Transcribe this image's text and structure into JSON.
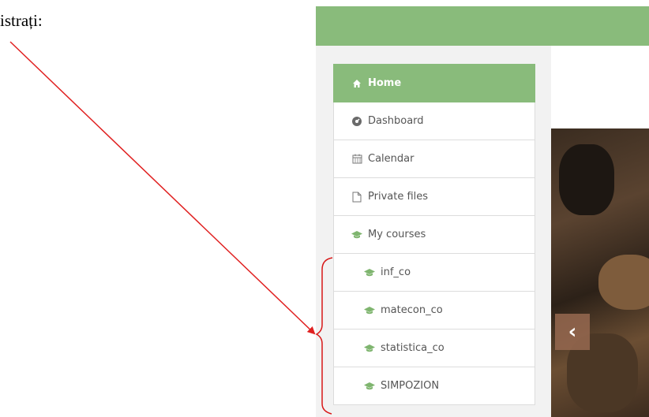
{
  "caption": {
    "text": "istrați:"
  },
  "nav": {
    "items": [
      {
        "label": "Home",
        "icon": "home-icon"
      },
      {
        "label": "Dashboard",
        "icon": "dashboard-icon"
      },
      {
        "label": "Calendar",
        "icon": "calendar-icon"
      },
      {
        "label": "Private files",
        "icon": "file-icon"
      },
      {
        "label": "My courses",
        "icon": "graduation-cap-icon"
      },
      {
        "label": "inf_co",
        "icon": "graduation-cap-icon"
      },
      {
        "label": "matecon_co",
        "icon": "graduation-cap-icon"
      },
      {
        "label": "statistica_co",
        "icon": "graduation-cap-icon"
      },
      {
        "label": "SIMPOZION",
        "icon": "graduation-cap-icon"
      }
    ]
  },
  "carousel": {
    "prev_glyph": "‹"
  },
  "colors": {
    "accent": "#89bb7b",
    "annotation": "#e02020"
  }
}
